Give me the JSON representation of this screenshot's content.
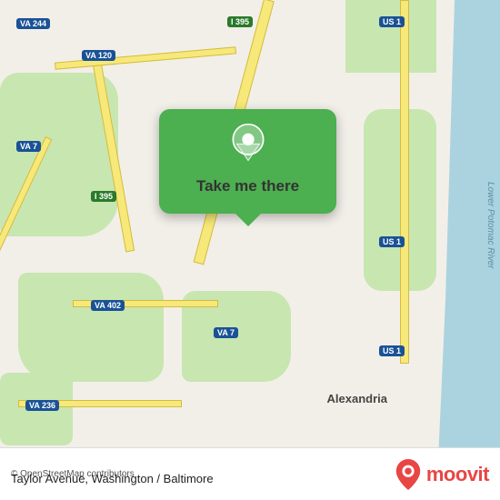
{
  "map": {
    "water_label": "Lower Potomac River",
    "osm_credit": "© OpenStreetMap contributors",
    "location_name": "Taylor Avenue, Washington / Baltimore"
  },
  "popup": {
    "button_label": "Take me there"
  },
  "shields": {
    "va244": "VA 244",
    "va120": "VA 120",
    "i395_top": "I 395",
    "us1_top": "US 1",
    "va7_left": "VA 7",
    "i395_left": "I 395",
    "va402": "VA 402",
    "us1_mid": "US 1",
    "va7_mid": "VA 7",
    "va236": "VA 236",
    "us1_bot": "US 1",
    "alexandria": "Alexandria"
  },
  "branding": {
    "moovit": "moovit"
  }
}
